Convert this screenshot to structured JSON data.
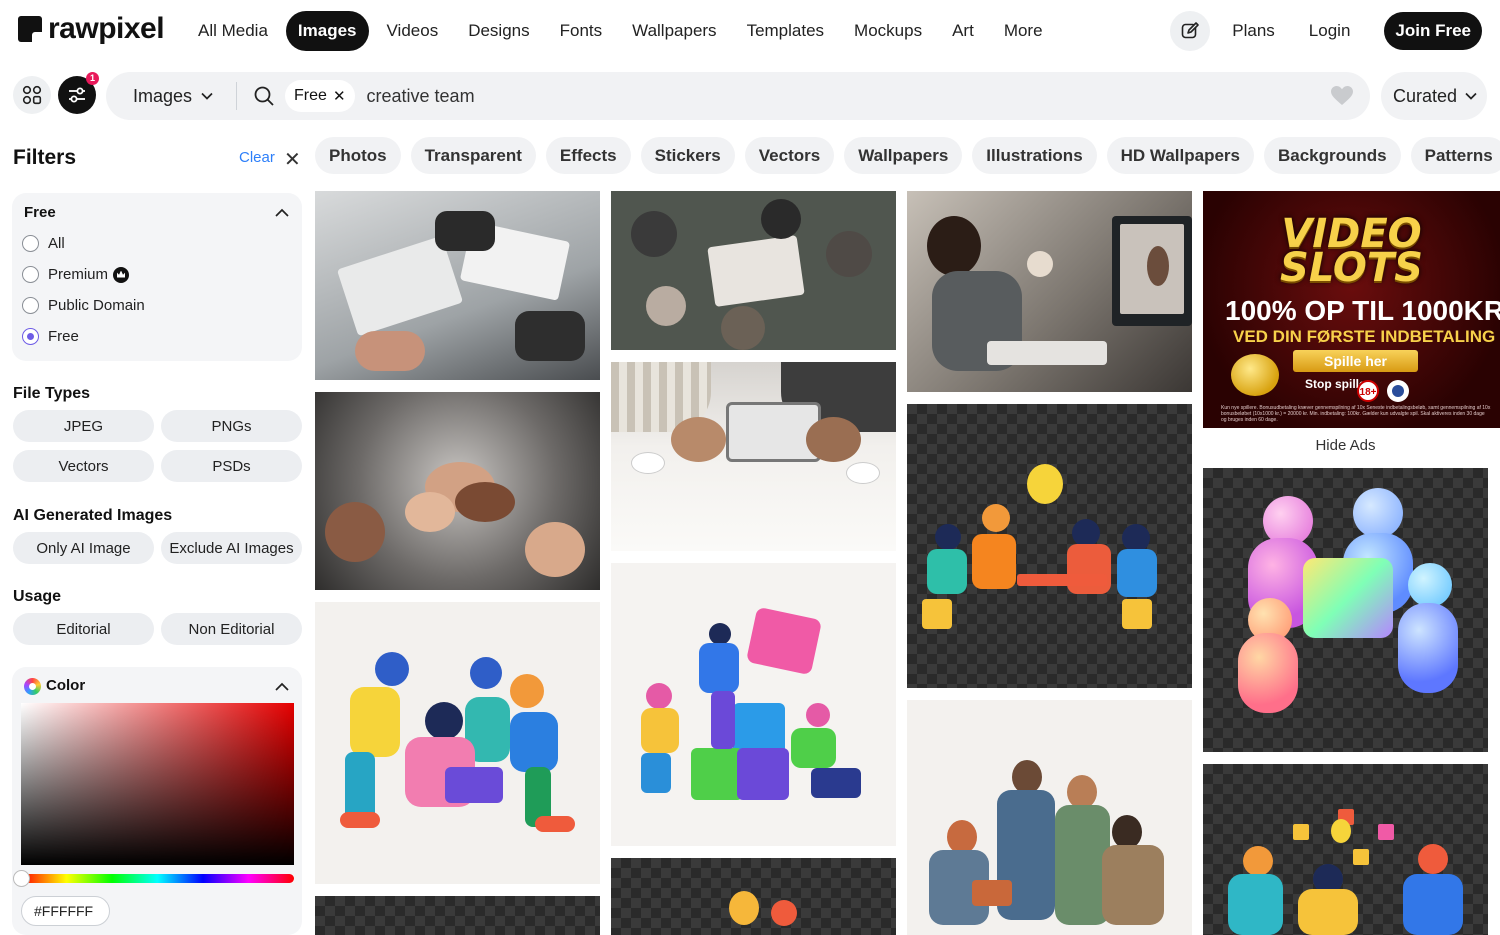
{
  "brand": {
    "logo_text": "rawpixel"
  },
  "nav": {
    "links": [
      "All Media",
      "Images",
      "Videos",
      "Designs",
      "Fonts",
      "Wallpapers",
      "Templates",
      "Mockups",
      "Art",
      "More"
    ],
    "active": "Images",
    "plans": "Plans",
    "login": "Login",
    "join": "Join Free"
  },
  "search": {
    "badge_count": "1",
    "type_label": "Images",
    "free_chip": "Free",
    "query": "creative team",
    "sort_label": "Curated"
  },
  "filters": {
    "title": "Filters",
    "clear": "Clear",
    "license": {
      "title": "Free",
      "options": [
        "All",
        "Premium",
        "Public Domain",
        "Free"
      ],
      "selected": "Free"
    },
    "file_types": {
      "title": "File Types",
      "options": [
        "JPEG",
        "PNGs",
        "Vectors",
        "PSDs"
      ]
    },
    "ai": {
      "title": "AI Generated Images",
      "options": [
        "Only AI Image",
        "Exclude AI Images"
      ]
    },
    "usage": {
      "title": "Usage",
      "options": [
        "Editorial",
        "Non Editorial"
      ]
    },
    "color": {
      "title": "Color",
      "hex_value": "#FFFFFF",
      "hue_color": "#e50000"
    }
  },
  "categories": [
    "Photos",
    "Transparent",
    "Effects",
    "Stickers",
    "Vectors",
    "Wallpapers",
    "Illustrations",
    "HD Wallpapers",
    "Backgrounds",
    "Patterns"
  ],
  "ad": {
    "logo_line1": "VIDEO",
    "logo_line2": "SLOTS",
    "headline": "100% OP TIL 1000KR",
    "subline": "VED DIN FØRSTE INDBETALING",
    "cta": "Spille her",
    "stop_label": "Stop spillet",
    "age_label": "18+",
    "fine_print": "Kun nye spillere. Bonusudbetaling kræver gennemspilning af 10x Seneste indbetalingsbeløb, samt gennemspilning af 10x bonusbeløbet (10x1000 kr.) = 20000 kr. Min. indbetaling: 100kr. Gælder kun udvalgte spil. Skal aktiveres inden 30 dage og bruges inden 60 dage.",
    "hide_label": "Hide Ads"
  },
  "results": [
    {
      "name": "photo-team-desk-papers",
      "type": "photo",
      "bg": "#b9bcbf"
    },
    {
      "name": "photo-team-hands-stack",
      "type": "photo",
      "bg": "#6f6c6a"
    },
    {
      "name": "illustration-happy-team-laptop",
      "type": "illustration",
      "bg": "#f3f1ee"
    },
    {
      "name": "photo-top-view-meeting",
      "type": "photo",
      "bg": "#505651"
    },
    {
      "name": "photo-tablet-coffee-table",
      "type": "photo",
      "bg": "#e7e5e2"
    },
    {
      "name": "illustration-puzzle-teamwork",
      "type": "illustration",
      "bg": "#f5f3f1"
    },
    {
      "name": "sticker-lightbulb-team",
      "type": "transparent",
      "bg": "#3a3a3a"
    },
    {
      "name": "photo-creative-studio-computer",
      "type": "photo",
      "bg": "#8a8580"
    },
    {
      "name": "sticker-team-idea-table",
      "type": "transparent",
      "bg": "#3a3a3a"
    },
    {
      "name": "illustration-business-team",
      "type": "illustration",
      "bg": "#f3f1ee"
    },
    {
      "name": "sticker-3d-puzzle-people",
      "type": "transparent",
      "bg": "#3a3a3a"
    },
    {
      "name": "sticker-team-sticky-notes",
      "type": "transparent",
      "bg": "#3a3a3a"
    }
  ]
}
